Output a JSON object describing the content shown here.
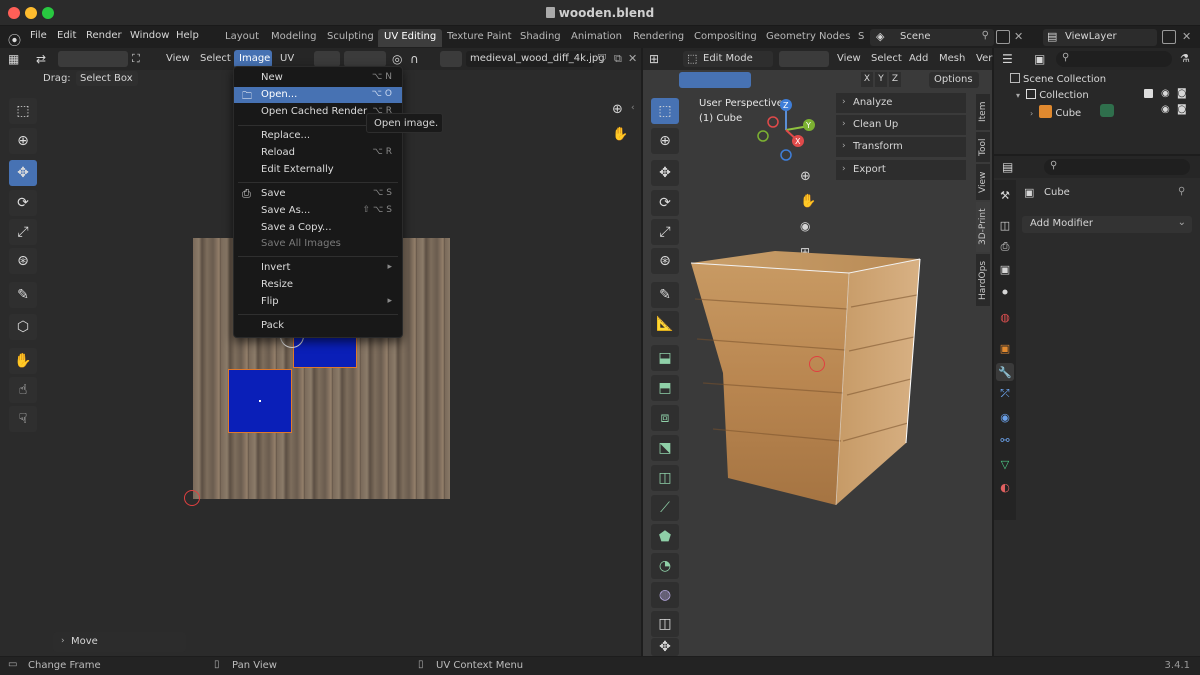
{
  "window": {
    "title": "wooden.blend"
  },
  "menubar": {
    "items": [
      "File",
      "Edit",
      "Render",
      "Window",
      "Help"
    ],
    "workspaces": [
      "Layout",
      "Modeling",
      "Sculpting",
      "UV Editing",
      "Texture Paint",
      "Shading",
      "Animation",
      "Rendering",
      "Compositing",
      "Geometry Nodes",
      "S"
    ],
    "active_workspace": "UV Editing",
    "scene": "Scene",
    "view_layer": "ViewLayer"
  },
  "uv_editor": {
    "header_menus": [
      "View",
      "Select",
      "Image",
      "UV"
    ],
    "image_name": "medieval_wood_diff_4k.jpg",
    "drag_label": "Drag:",
    "drag_value": "Select Box",
    "last_operator": "Move"
  },
  "image_menu": {
    "items": [
      {
        "label": "New",
        "shortcut": "⌥ N"
      },
      {
        "label": "Open...",
        "shortcut": "⌥ O"
      },
      {
        "label": "Open Cached Render",
        "shortcut": "⌥ R"
      },
      {
        "label": "Replace...",
        "shortcut": ""
      },
      {
        "label": "Reload",
        "shortcut": "⌥ R"
      },
      {
        "label": "Edit Externally",
        "shortcut": ""
      },
      {
        "label": "Save",
        "shortcut": "⌥ S"
      },
      {
        "label": "Save As...",
        "shortcut": "⇧ ⌥ S"
      },
      {
        "label": "Save a Copy...",
        "shortcut": ""
      },
      {
        "label": "Save All Images",
        "shortcut": ""
      },
      {
        "label": "Invert",
        "shortcut": "▸"
      },
      {
        "label": "Resize",
        "shortcut": ""
      },
      {
        "label": "Flip",
        "shortcut": "▸"
      },
      {
        "label": "Pack",
        "shortcut": ""
      }
    ],
    "tooltip": "Open image."
  },
  "viewport": {
    "mode": "Edit Mode",
    "header_menus": [
      "View",
      "Select",
      "Add",
      "Mesh",
      "Ver"
    ],
    "axes": [
      "X",
      "Y",
      "Z"
    ],
    "options_label": "Options",
    "perspective_label": "User Perspective",
    "object_label": "(1) Cube",
    "sidebar_panels": [
      "Analyze",
      "Clean Up",
      "Transform",
      "Export"
    ],
    "side_tabs": [
      "Item",
      "Tool",
      "View",
      "3D-Print",
      "HardOps"
    ]
  },
  "outliner": {
    "root": "Scene Collection",
    "collection": "Collection",
    "object": "Cube"
  },
  "properties": {
    "object_name": "Cube",
    "add_modifier": "Add Modifier"
  },
  "statusbar": {
    "items": [
      "Change Frame",
      "Pan View",
      "UV Context Menu"
    ],
    "version": "3.4.1"
  },
  "colors": {
    "accent": "#4772b3",
    "uv_island": "#0a1fb8",
    "uv_island_border": "#e07a2c",
    "wood_light": "#c89a63",
    "wood_dark": "#6d5a48"
  }
}
